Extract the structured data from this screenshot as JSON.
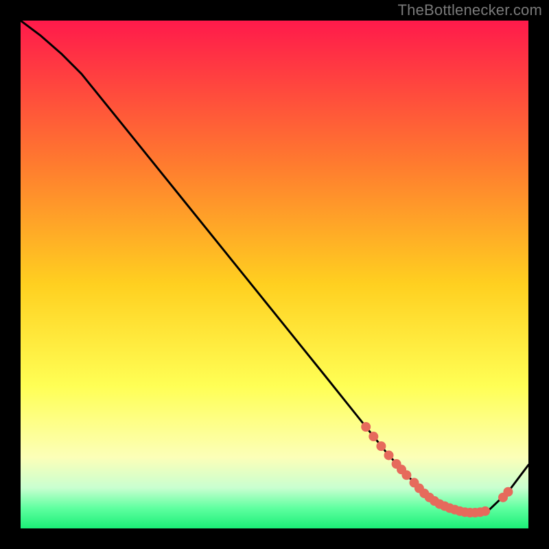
{
  "attribution": "TheBottlenecker.com",
  "colors": {
    "gradient_top": "#ff1a4b",
    "gradient_mid1": "#ff7a2f",
    "gradient_mid2": "#ffd020",
    "gradient_mid3": "#ffff55",
    "gradient_mid4": "#fcffb8",
    "gradient_bot1": "#c9ffd0",
    "gradient_bot2": "#5fffa0",
    "gradient_bottom": "#1bef77",
    "line": "#000000",
    "marker": "#e66a5c",
    "background": "#000000"
  },
  "chart_data": {
    "type": "line",
    "title": "",
    "xlabel": "",
    "ylabel": "",
    "xlim": [
      0,
      100
    ],
    "ylim": [
      0,
      100
    ],
    "series": [
      {
        "name": "curve",
        "x": [
          0,
          4,
          8,
          12,
          20,
          30,
          40,
          50,
          60,
          68,
          72,
          76,
          80,
          84,
          88,
          92,
          96,
          100
        ],
        "y": [
          100,
          97,
          93.5,
          89.5,
          79.6,
          67.2,
          54.8,
          42.4,
          30.0,
          20.0,
          15.0,
          10.5,
          6.8,
          4.3,
          3.1,
          3.4,
          7.2,
          12.5
        ]
      }
    ],
    "markers": [
      {
        "x": 68.0,
        "y": 20.0
      },
      {
        "x": 69.5,
        "y": 18.1
      },
      {
        "x": 71.0,
        "y": 16.2
      },
      {
        "x": 72.5,
        "y": 14.4
      },
      {
        "x": 74.0,
        "y": 12.7
      },
      {
        "x": 75.0,
        "y": 11.6
      },
      {
        "x": 76.0,
        "y": 10.5
      },
      {
        "x": 77.5,
        "y": 9.0
      },
      {
        "x": 78.5,
        "y": 7.9
      },
      {
        "x": 79.5,
        "y": 6.9
      },
      {
        "x": 80.5,
        "y": 6.1
      },
      {
        "x": 81.5,
        "y": 5.4
      },
      {
        "x": 82.5,
        "y": 4.8
      },
      {
        "x": 83.5,
        "y": 4.4
      },
      {
        "x": 84.5,
        "y": 4.0
      },
      {
        "x": 85.5,
        "y": 3.7
      },
      {
        "x": 86.5,
        "y": 3.4
      },
      {
        "x": 87.5,
        "y": 3.2
      },
      {
        "x": 88.5,
        "y": 3.1
      },
      {
        "x": 89.5,
        "y": 3.1
      },
      {
        "x": 90.5,
        "y": 3.2
      },
      {
        "x": 91.5,
        "y": 3.4
      },
      {
        "x": 95.0,
        "y": 6.1
      },
      {
        "x": 96.0,
        "y": 7.2
      }
    ]
  }
}
